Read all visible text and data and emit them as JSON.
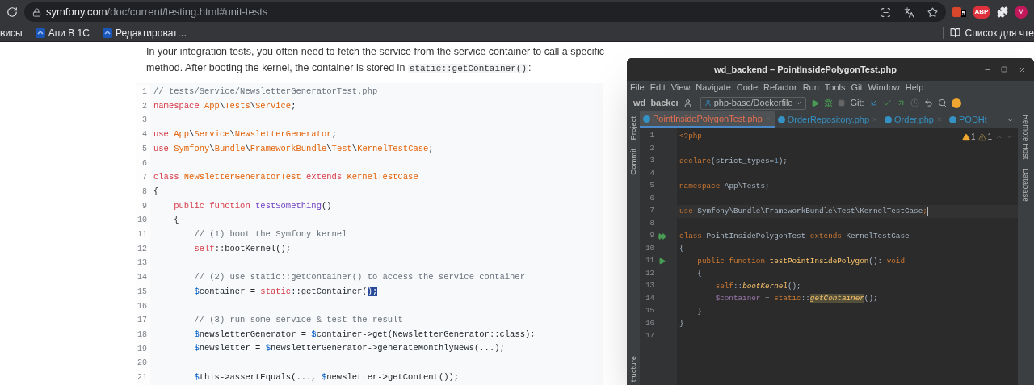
{
  "browser": {
    "url_host": "symfony.com",
    "url_path": "/doc/current/testing.html#unit-tests",
    "extension_badge": "5",
    "adblock_label": "ABP",
    "avatar_letter": "M",
    "bookmarks": [
      {
        "label": "висы",
        "kind": "plain"
      },
      {
        "label": "Апи В 1С",
        "kind": "site"
      },
      {
        "label": "Редактироват…",
        "kind": "site"
      }
    ],
    "reading_list": "Список для чте"
  },
  "article": {
    "paragraph_top": "In your integration tests, you often need to fetch the service from the service container to call a specific",
    "paragraph_text": "method. After booting the kernel, the container is stored in ",
    "inline_code": "static::getContainer()",
    "paragraph_end": ":",
    "code_lines": [
      {
        "number": "1",
        "segments": [
          {
            "text": "// tests/Service/NewsletterGeneratorTest.php",
            "kind": "cmt"
          }
        ]
      },
      {
        "number": "2",
        "segments": [
          {
            "text": "namespace ",
            "kind": "kw"
          },
          {
            "text": "App",
            "kind": "cls"
          },
          {
            "text": "\\",
            "kind": "p"
          },
          {
            "text": "Tests",
            "kind": "cls"
          },
          {
            "text": "\\",
            "kind": "p"
          },
          {
            "text": "Service",
            "kind": "cls"
          },
          {
            "text": ";",
            "kind": "p"
          }
        ]
      },
      {
        "number": "3"
      },
      {
        "number": "4",
        "segments": [
          {
            "text": "use ",
            "kind": "kw"
          },
          {
            "text": "App",
            "kind": "cls"
          },
          {
            "text": "\\",
            "kind": "p"
          },
          {
            "text": "Service",
            "kind": "cls"
          },
          {
            "text": "\\",
            "kind": "p"
          },
          {
            "text": "NewsletterGenerator",
            "kind": "cls"
          },
          {
            "text": ";",
            "kind": "p"
          }
        ]
      },
      {
        "number": "5",
        "segments": [
          {
            "text": "use ",
            "kind": "kw"
          },
          {
            "text": "Symfony",
            "kind": "cls"
          },
          {
            "text": "\\",
            "kind": "p"
          },
          {
            "text": "Bundle",
            "kind": "cls"
          },
          {
            "text": "\\",
            "kind": "p"
          },
          {
            "text": "FrameworkBundle",
            "kind": "cls"
          },
          {
            "text": "\\",
            "kind": "p"
          },
          {
            "text": "Test",
            "kind": "cls"
          },
          {
            "text": "\\",
            "kind": "p"
          },
          {
            "text": "KernelTestCase",
            "kind": "cls"
          },
          {
            "text": ";",
            "kind": "p"
          }
        ]
      },
      {
        "number": "6"
      },
      {
        "number": "7",
        "segments": [
          {
            "text": "class ",
            "kind": "kw"
          },
          {
            "text": "NewsletterGeneratorTest ",
            "kind": "cls"
          },
          {
            "text": "extends ",
            "kind": "kw"
          },
          {
            "text": "KernelTestCase",
            "kind": "cls"
          }
        ]
      },
      {
        "number": "8",
        "segments": [
          {
            "text": "{",
            "kind": "p"
          }
        ]
      },
      {
        "number": "9",
        "segments": [
          {
            "text": "    public function ",
            "kind": "kw"
          },
          {
            "text": "testSomething",
            "kind": "fn"
          },
          {
            "text": "()",
            "kind": "p"
          }
        ]
      },
      {
        "number": "10",
        "segments": [
          {
            "text": "    {",
            "kind": "p"
          }
        ]
      },
      {
        "number": "11",
        "segments": [
          {
            "text": "        // (1) boot the Symfony kernel",
            "kind": "cmt"
          }
        ]
      },
      {
        "number": "12",
        "segments": [
          {
            "text": "        self",
            "kind": "kw"
          },
          {
            "text": "::bootKernel();",
            "kind": "p"
          }
        ]
      },
      {
        "number": "13"
      },
      {
        "number": "14",
        "segments": [
          {
            "text": "        // (2) use static::getContainer() to access the service container",
            "kind": "cmt"
          }
        ]
      },
      {
        "number": "15",
        "segments": [
          {
            "text": "        $",
            "kind": "var"
          },
          {
            "text": "container = ",
            "kind": "p"
          },
          {
            "text": "static",
            "kind": "kw"
          },
          {
            "text": "::getContainer(",
            "kind": "p"
          },
          {
            "text": ");",
            "kind": "sel"
          }
        ]
      },
      {
        "number": "16"
      },
      {
        "number": "17",
        "segments": [
          {
            "text": "        // (3) run some service & test the result",
            "kind": "cmt"
          }
        ]
      },
      {
        "number": "18",
        "segments": [
          {
            "text": "        $",
            "kind": "var"
          },
          {
            "text": "newsletterGenerator = ",
            "kind": "p"
          },
          {
            "text": "$",
            "kind": "var"
          },
          {
            "text": "container->get(NewsletterGenerator::class);",
            "kind": "p"
          }
        ]
      },
      {
        "number": "19",
        "segments": [
          {
            "text": "        $",
            "kind": "var"
          },
          {
            "text": "newsletter = ",
            "kind": "p"
          },
          {
            "text": "$",
            "kind": "var"
          },
          {
            "text": "newsletterGenerator->generateMonthlyNews(...);",
            "kind": "p"
          }
        ]
      },
      {
        "number": "20"
      },
      {
        "number": "21",
        "segments": [
          {
            "text": "        $",
            "kind": "var"
          },
          {
            "text": "this->assertEquals(..., ",
            "kind": "p"
          },
          {
            "text": "$",
            "kind": "var"
          },
          {
            "text": "newsletter->getContent());",
            "kind": "p"
          }
        ]
      }
    ]
  },
  "ide": {
    "title": "wd_backend – PointInsidePolygonTest.php",
    "menu": [
      "File",
      "Edit",
      "View",
      "Navigate",
      "Code",
      "Refactor",
      "Run",
      "Tools",
      "Git",
      "Window",
      "Help"
    ],
    "project": "wd_backeı",
    "run_config": "php-base/Dockerfile",
    "git_label": "Git:",
    "tabs": [
      {
        "label": "PointInsidePolygonTest.php",
        "selected": true
      },
      {
        "label": "OrderRepository.php",
        "selected": false
      },
      {
        "label": "Order.php",
        "selected": false
      },
      {
        "label": "PODHt",
        "selected": false
      }
    ],
    "left_tools": [
      "Project",
      "Commit"
    ],
    "left_bottom_tool": "tructure",
    "right_tools": [
      "Remote Host",
      "Database"
    ],
    "warnings": [
      {
        "count": "1",
        "kind": "warning"
      },
      {
        "count": "1",
        "kind": "weak"
      }
    ],
    "lines": [
      {
        "number": "1",
        "segments": [
          {
            "text": "<?php",
            "kind": "kw"
          }
        ]
      },
      {
        "number": "2"
      },
      {
        "number": "3",
        "segments": [
          {
            "text": "declare",
            "kind": "kw"
          },
          {
            "text": "(strict_types=",
            "kind": "p"
          },
          {
            "text": "1",
            "kind": "num"
          },
          {
            "text": ");",
            "kind": "p"
          }
        ]
      },
      {
        "number": "4"
      },
      {
        "number": "5",
        "segments": [
          {
            "text": "namespace ",
            "kind": "kw"
          },
          {
            "text": "App\\Tests;",
            "kind": "p"
          }
        ]
      },
      {
        "number": "6"
      },
      {
        "number": "7",
        "current": true,
        "segments": [
          {
            "text": "use ",
            "kind": "kw"
          },
          {
            "text": "Symfony\\Bundle\\FrameworkBundle\\Test\\KernelTestCase",
            "kind": "p"
          },
          {
            "text": ";",
            "kind": "kw"
          }
        ]
      },
      {
        "number": "8"
      },
      {
        "number": "9",
        "gutter": {
          "kind": "run-all"
        },
        "segments": [
          {
            "text": "class ",
            "kind": "kw"
          },
          {
            "text": "PointInsidePolygonTest ",
            "kind": "p"
          },
          {
            "text": "extends ",
            "kind": "kw"
          },
          {
            "text": "KernelTestCase",
            "kind": "p"
          }
        ]
      },
      {
        "number": "10",
        "segments": [
          {
            "text": "{",
            "kind": "p"
          }
        ]
      },
      {
        "number": "11",
        "gutter": {
          "kind": "run"
        },
        "segments": [
          {
            "text": "    public function ",
            "kind": "kw"
          },
          {
            "text": "testPointInsidePolygon",
            "kind": "fn"
          },
          {
            "text": "(): ",
            "kind": "p"
          },
          {
            "text": "void",
            "kind": "kw"
          }
        ]
      },
      {
        "number": "12",
        "segments": [
          {
            "text": "    {",
            "kind": "p"
          }
        ]
      },
      {
        "number": "13",
        "segments": [
          {
            "text": "        self",
            "kind": "kw"
          },
          {
            "text": "::",
            "kind": "p"
          },
          {
            "text": "bootKernel",
            "kind": "fni"
          },
          {
            "text": "();",
            "kind": "p"
          }
        ]
      },
      {
        "number": "14",
        "segments": [
          {
            "text": "        $container",
            "kind": "var"
          },
          {
            "text": " = ",
            "kind": "p"
          },
          {
            "text": "static",
            "kind": "kw"
          },
          {
            "text": "::",
            "kind": "p"
          },
          {
            "text": "getContainer",
            "kind": "hl"
          },
          {
            "text": "();",
            "kind": "p"
          }
        ]
      },
      {
        "number": "15",
        "segments": [
          {
            "text": "    }",
            "kind": "p"
          }
        ]
      },
      {
        "number": "16",
        "segments": [
          {
            "text": "}",
            "kind": "p"
          }
        ]
      },
      {
        "number": "17"
      }
    ]
  }
}
